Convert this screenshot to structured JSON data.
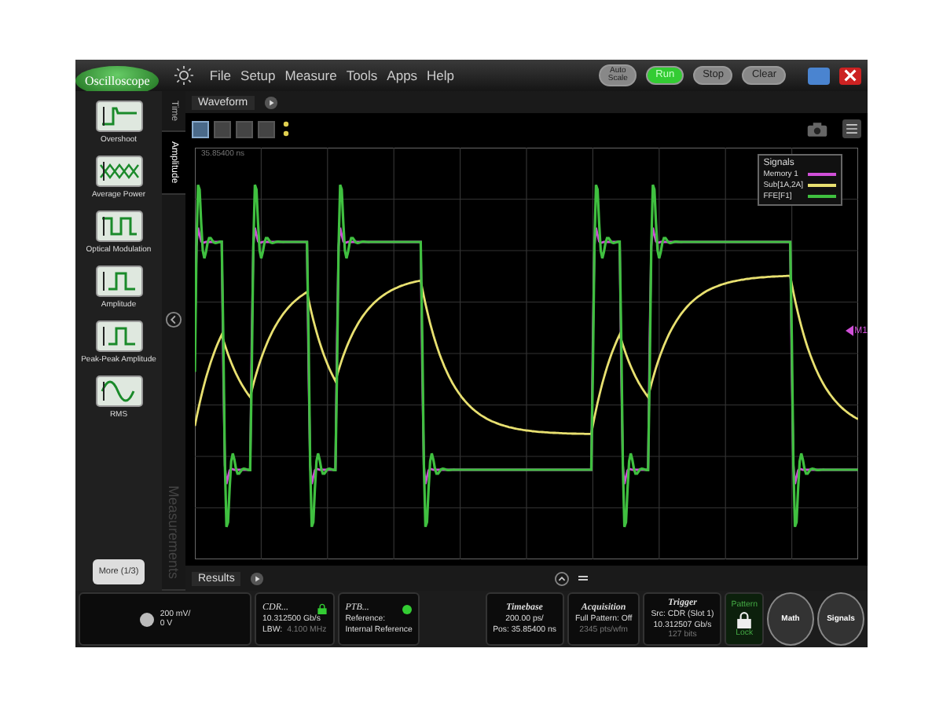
{
  "app": {
    "logo": "Oscilloscope"
  },
  "menu": [
    "File",
    "Setup",
    "Measure",
    "Tools",
    "Apps",
    "Help"
  ],
  "run_controls": [
    {
      "label": "Auto Scale",
      "on": false
    },
    {
      "label": "Run",
      "on": true
    },
    {
      "label": "Stop",
      "on": false
    },
    {
      "label": "Clear",
      "on": false
    }
  ],
  "sidebar": {
    "items": [
      {
        "label": "Overshoot",
        "kind": "overshoot"
      },
      {
        "label": "Average Power",
        "kind": "average"
      },
      {
        "label": "Optical Modulation",
        "kind": "modulation"
      },
      {
        "label": "Amplitude",
        "kind": "amplitude"
      },
      {
        "label": "Peak-Peak Amplitude",
        "kind": "peak"
      },
      {
        "label": "RMS",
        "kind": "rms"
      }
    ],
    "more": "More (1/3)"
  },
  "vertical_tabs": [
    {
      "label": "Time",
      "selected": false
    },
    {
      "label": "Amplitude",
      "selected": true
    },
    {
      "label": "Measurements",
      "selected": false
    }
  ],
  "waveform_tab": "Waveform",
  "layout_buttons": [
    {
      "selected": true
    },
    {
      "selected": false
    },
    {
      "selected": false
    },
    {
      "selected": false
    }
  ],
  "plot": {
    "position_label": "35.85400 ns",
    "marker": "M1"
  },
  "legend": {
    "title": "Signals",
    "items": [
      {
        "name": "Memory 1",
        "color": "#d050d8"
      },
      {
        "name": "Sub[1A,2A]",
        "color": "#e8e070"
      },
      {
        "name": "FFE[F1]",
        "color": "#40c040"
      }
    ]
  },
  "results_tab": "Results",
  "status": {
    "channel": {
      "scale": "200 mV/",
      "offset": "0 V"
    },
    "cdr": {
      "title": "CDR...",
      "rate": "10.312500 Gb/s",
      "lbw_label": "LBW:",
      "lbw": "4.100 MHz",
      "locked": true
    },
    "ptb": {
      "title": "PTB...",
      "line1": "Reference:",
      "line2": "Internal Reference",
      "on": true
    },
    "timebase": {
      "title": "Timebase",
      "line1": "200.00 ps/",
      "line2": "Pos: 35.85400 ns"
    },
    "acquisition": {
      "title": "Acquisition",
      "line1": "Full Pattern: Off",
      "line2": "2345 pts/wfm"
    },
    "trigger": {
      "title": "Trigger",
      "line1": "Src: CDR (Slot 1)",
      "line2": "10.312507 Gb/s",
      "line3": "127 bits"
    },
    "pattern": {
      "title": "Pattern",
      "state": "Lock"
    },
    "buttons": [
      "Math",
      "Signals"
    ]
  }
}
